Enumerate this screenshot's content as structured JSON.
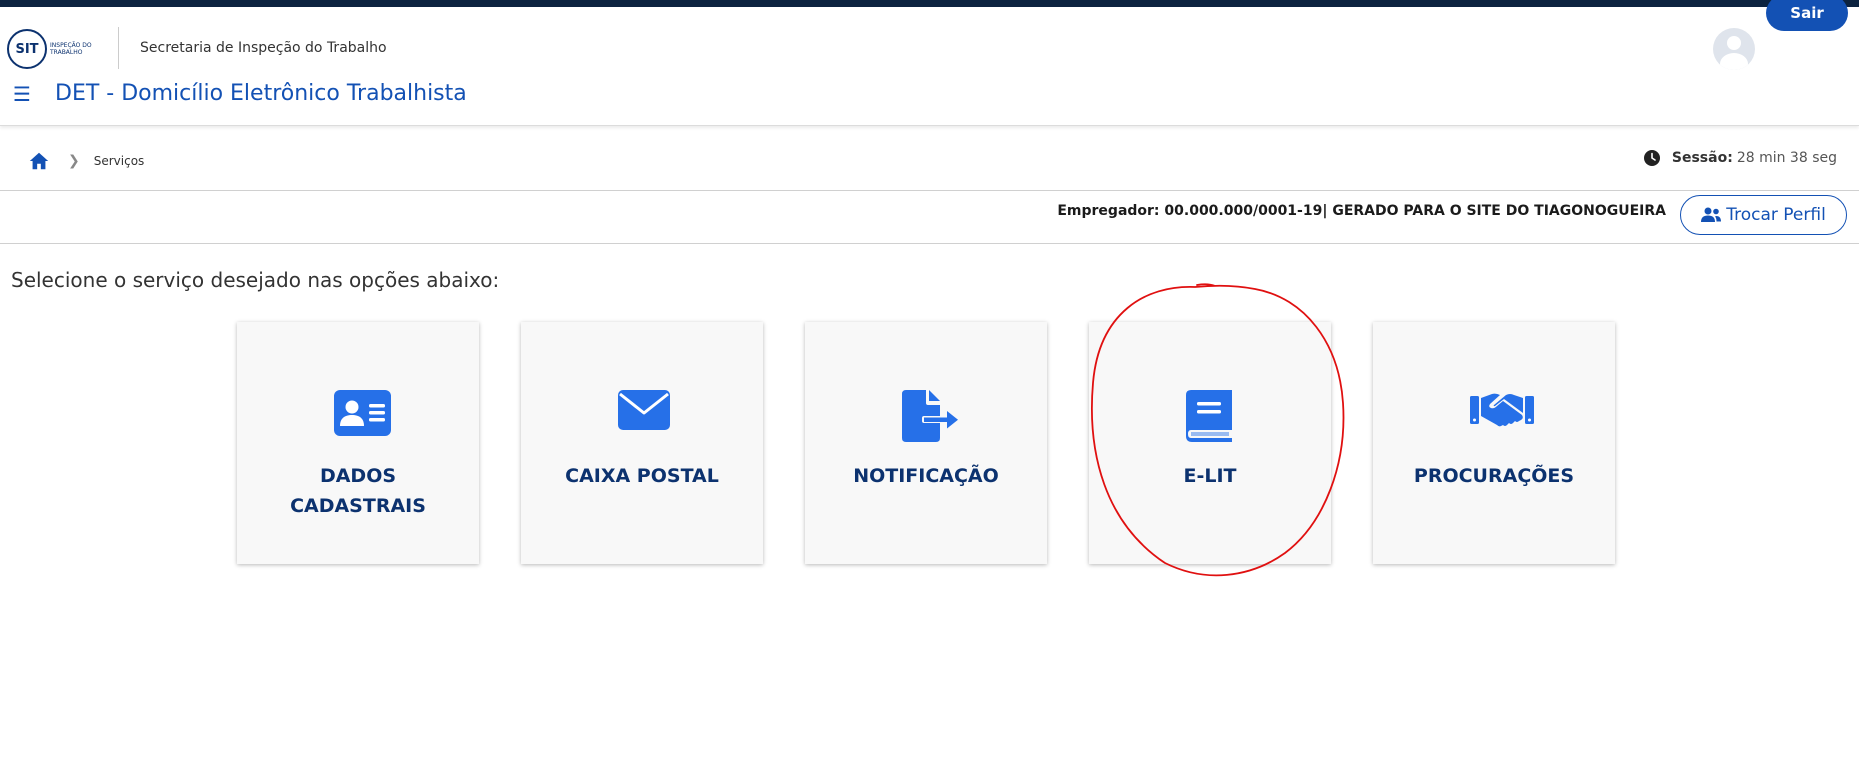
{
  "header": {
    "logo_text": "SIT",
    "logo_subtitle": "Inspeção do Trabalho",
    "agency_name": "Secretaria de Inspeção do Trabalho",
    "logout_label": "Sair",
    "menu_icon": "☰",
    "app_title": "DET - Domicílio Eletrônico Trabalhista"
  },
  "breadcrumb": {
    "items": [
      "Serviços"
    ]
  },
  "session": {
    "label": "Sessão:",
    "value": "28 min 38 seg"
  },
  "profile": {
    "employer_text": "Empregador: 00.000.000/0001-19| GERADO PARA O SITE DO TIAGONOGUEIRA",
    "switch_label": "Trocar Perfil"
  },
  "main": {
    "prompt": "Selecione o serviço desejado nas opções abaixo:",
    "services": [
      {
        "label_line1": "DADOS",
        "label_line2": "CADASTRAIS",
        "icon": "id-card-icon"
      },
      {
        "label_line1": "CAIXA POSTAL",
        "label_line2": "",
        "icon": "envelope-icon"
      },
      {
        "label_line1": "NOTIFICAÇÃO",
        "label_line2": "",
        "icon": "file-export-icon"
      },
      {
        "label_line1": "E-LIT",
        "label_line2": "",
        "icon": "book-icon"
      },
      {
        "label_line1": "PROCURAÇÕES",
        "label_line2": "",
        "icon": "handshake-icon"
      }
    ]
  },
  "colors": {
    "primary": "#1351b4",
    "dark_blue": "#0c326f",
    "icon_blue": "#2670e8",
    "annotation_red": "#e01010"
  }
}
